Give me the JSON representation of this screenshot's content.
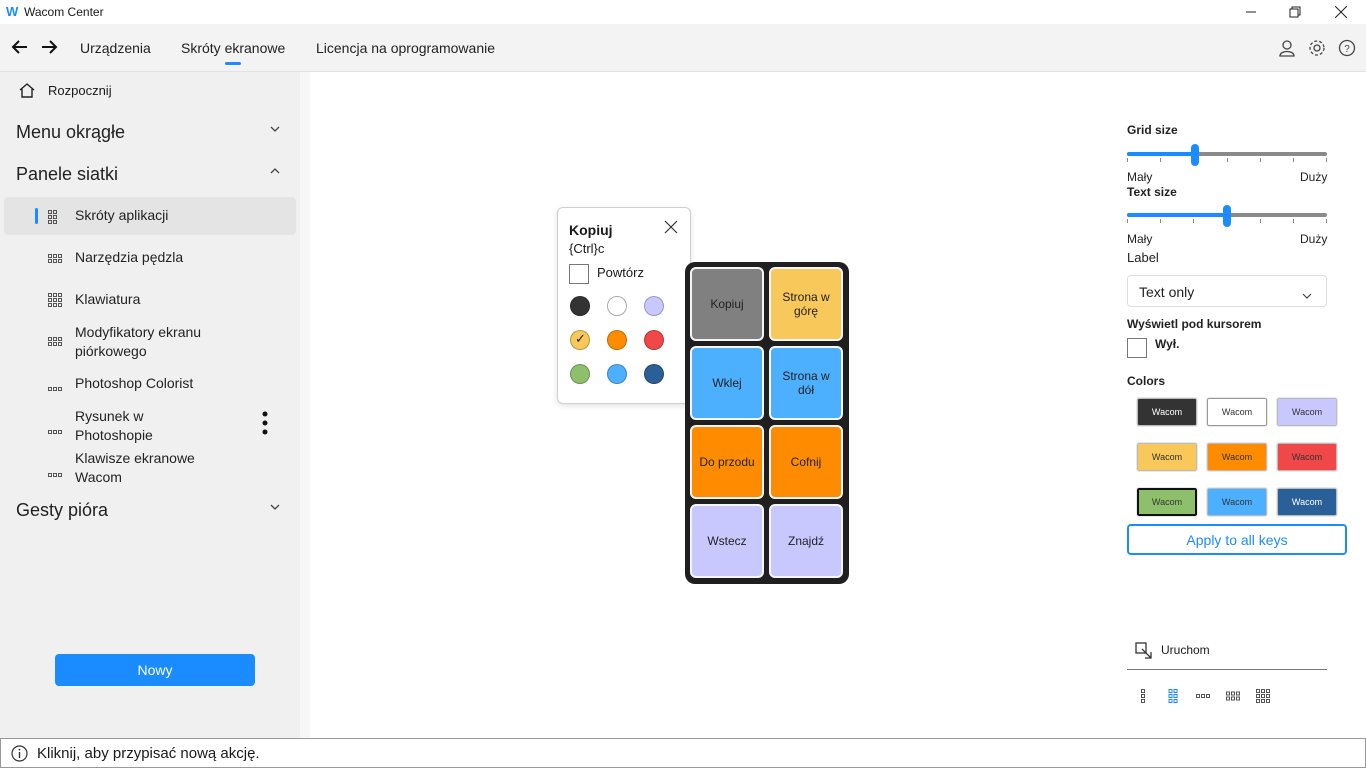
{
  "window": {
    "logo": "W",
    "title": "Wacom Center"
  },
  "nav": {
    "tabs": [
      {
        "label": "Urządzenia"
      },
      {
        "label": "Skróty ekranowe",
        "active": true
      },
      {
        "label": "Licencja na oprogramowanie"
      }
    ]
  },
  "sidebar": {
    "home": "Rozpocznij",
    "sections": {
      "radial": "Menu okrągłe",
      "grid": "Panele siatki",
      "gestures": "Gesty pióra"
    },
    "items": [
      {
        "label": "Skróty aplikacji",
        "icon": "grid-3x3-icon",
        "selected": true
      },
      {
        "label": "Narzędzia pędzla",
        "icon": "grid-4x2-icon"
      },
      {
        "label": "Klawiatura",
        "icon": "grid-4x4-icon"
      },
      {
        "label": "Modyfikatory ekranu piórkowego",
        "icon": "grid-3x2-icon"
      },
      {
        "label": "Photoshop Colorist",
        "icon": "grid-3x1-icon"
      },
      {
        "label": "Rysunek w Photoshopie",
        "icon": "grid-3x1-icon"
      },
      {
        "label": "Klawisze ekranowe Wacom",
        "icon": "grid-3x1-icon"
      }
    ],
    "new_button": "Nowy"
  },
  "popup": {
    "title": "Kopiuj",
    "shortcut": "{Ctrl}c",
    "repeat_label": "Powtórz",
    "selected_swatch": 3,
    "swatches": [
      "#333333",
      "#ffffff",
      "#c8c8ff",
      "#f9c85a",
      "#ff8c00",
      "#f04848",
      "#8ec06c",
      "#4db0ff",
      "#2a5f97"
    ],
    "check_mark": "✓"
  },
  "panel": {
    "keys": [
      {
        "label": "Kopiuj",
        "color": "#808080"
      },
      {
        "label": "Strona w górę",
        "color": "#f9c85a"
      },
      {
        "label": "Wklej",
        "color": "#4db0ff"
      },
      {
        "label": "Strona w dół",
        "color": "#4db0ff"
      },
      {
        "label": "Do przodu",
        "color": "#ff8c00"
      },
      {
        "label": "Cofnij",
        "color": "#ff8c00"
      },
      {
        "label": "Wstecz",
        "color": "#c8c8ff"
      },
      {
        "label": "Znajdź",
        "color": "#c8c8ff"
      }
    ]
  },
  "right": {
    "grid_size": {
      "label": "Grid size",
      "min": "Mały",
      "max": "Duży",
      "value": 0.34
    },
    "text_size": {
      "label": "Text size",
      "min": "Mały",
      "max": "Duży",
      "value": 0.5
    },
    "label_heading": "Label",
    "label_value": "Text only",
    "show_under_cursor": "Wyświetl pod kursorem",
    "off_label": "Wył.",
    "colors_heading": "Colors",
    "color_keys": [
      {
        "text": "Wacom",
        "bg": "#333333",
        "fg": "#ffffff",
        "selected": false
      },
      {
        "text": "Wacom",
        "bg": "#ffffff",
        "fg": "#333333",
        "selected": false
      },
      {
        "text": "Wacom",
        "bg": "#c8c8ff",
        "fg": "#333333",
        "selected": false
      },
      {
        "text": "Wacom",
        "bg": "#f9c85a",
        "fg": "#333333",
        "selected": false
      },
      {
        "text": "Wacom",
        "bg": "#ff8c00",
        "fg": "#333333",
        "selected": false
      },
      {
        "text": "Wacom",
        "bg": "#f04848",
        "fg": "#333333",
        "selected": false
      },
      {
        "text": "Wacom",
        "bg": "#8ec06c",
        "fg": "#333333",
        "selected": true
      },
      {
        "text": "Wacom",
        "bg": "#4db0ff",
        "fg": "#333333",
        "selected": false
      },
      {
        "text": "Wacom",
        "bg": "#2a5f97",
        "fg": "#ffffff",
        "selected": false
      }
    ],
    "apply_button": "Apply to all keys",
    "launch": "Uruchom",
    "layout_icons": [
      "grid-1x3-icon",
      "grid-2x3-icon",
      "grid-3x1-icon",
      "grid-3x2-icon",
      "grid-3x3-icon"
    ],
    "selected_layout": 1
  },
  "status": {
    "text": "Kliknij, aby przypisać nową akcję."
  },
  "colors": {
    "accent": "#1a8cff"
  }
}
